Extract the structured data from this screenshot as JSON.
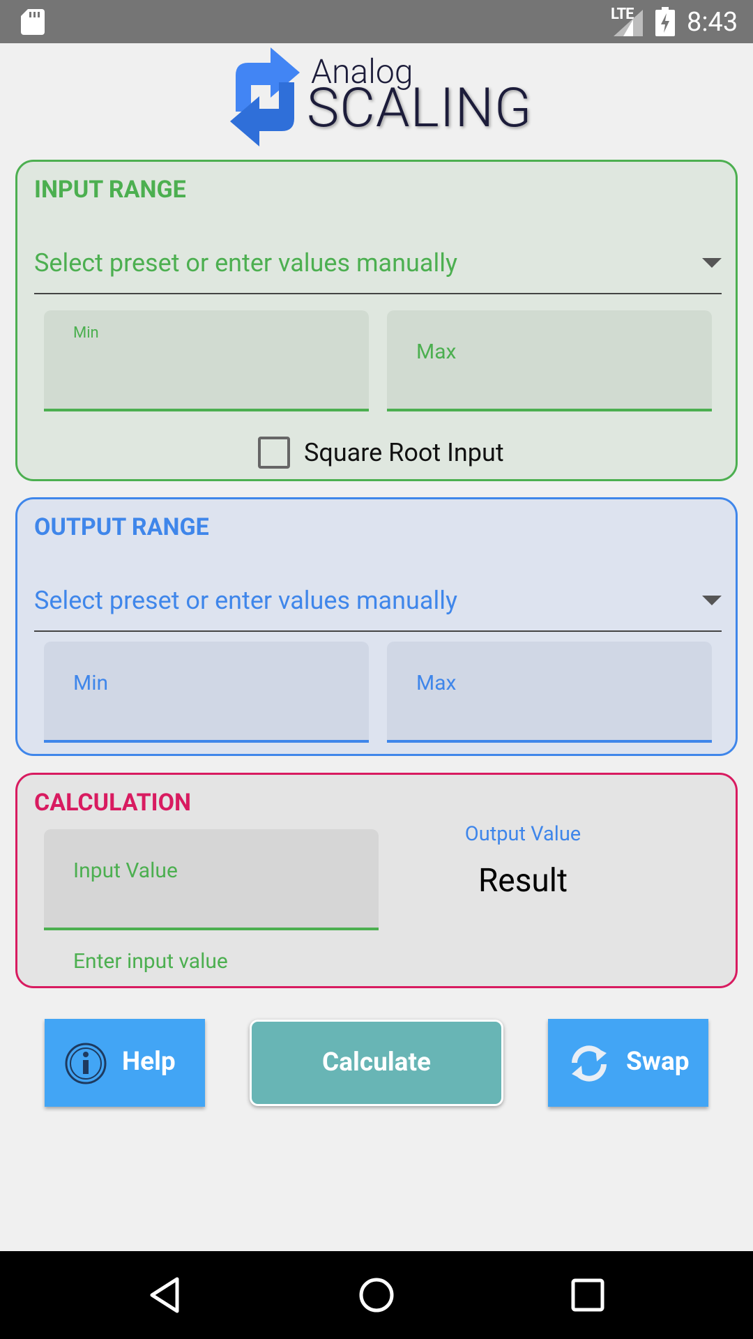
{
  "status_bar": {
    "network": "LTE",
    "time": "8:43"
  },
  "logo": {
    "small_text": "Analog",
    "big_text": "SCALING"
  },
  "input_range": {
    "title": "INPUT RANGE",
    "preset_placeholder": "Select preset or enter values manually",
    "min_label": "Min",
    "max_hint": "Max",
    "square_root_label": "Square Root Input",
    "square_root_checked": false,
    "accent_color": "#4caf50"
  },
  "output_range": {
    "title": "OUTPUT RANGE",
    "preset_placeholder": "Select preset or enter values manually",
    "min_hint": "Min",
    "max_hint": "Max",
    "accent_color": "#3f86ea"
  },
  "calculation": {
    "title": "CALCULATION",
    "input_hint": "Input Value",
    "helper_text": "Enter input value",
    "output_label": "Output Value",
    "result": "Result",
    "accent_color": "#d81b60"
  },
  "buttons": {
    "help": "Help",
    "calculate": "Calculate",
    "swap": "Swap"
  },
  "icons": {
    "sd_card": "sd-card-icon",
    "signal": "signal-icon",
    "battery": "battery-charging-icon",
    "info": "info-icon",
    "swap": "refresh-icon",
    "back": "back-icon",
    "home": "home-icon",
    "recents": "recents-icon"
  }
}
